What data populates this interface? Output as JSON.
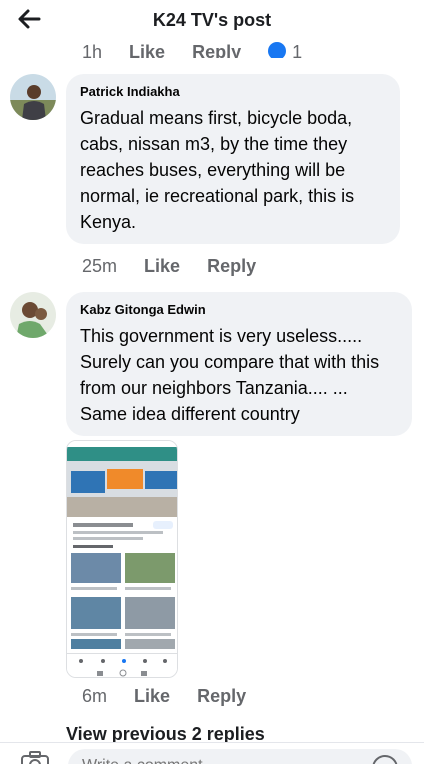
{
  "header": {
    "title": "K24 TV's post"
  },
  "previous_comment_actions": {
    "time": "1h",
    "like": "Like",
    "reply": "Reply",
    "reaction_count": "1"
  },
  "comments": [
    {
      "author": "Patrick Indiakha",
      "text": "Gradual means first, bicycle boda, cabs, nissan m3, by the time they reaches buses, everything will be normal, ie recreational park, this is Kenya.",
      "time": "25m",
      "like": "Like",
      "reply": "Reply"
    },
    {
      "author": "Kabz Gitonga Edwin",
      "text": "This government is very useless..... Surely can you compare that with this from our neighbors Tanzania.... ... Same idea different country",
      "time": "6m",
      "like": "Like",
      "reply": "Reply"
    }
  ],
  "view_replies": "View previous 2 replies",
  "composer": {
    "placeholder": "Write a comment..."
  },
  "colors": {
    "bubble": "#f0f2f5",
    "action_gray": "#65676b",
    "facebook_blue": "#1877f2"
  },
  "icons": [
    "back-arrow-icon",
    "camera-icon",
    "emoji-icon"
  ]
}
